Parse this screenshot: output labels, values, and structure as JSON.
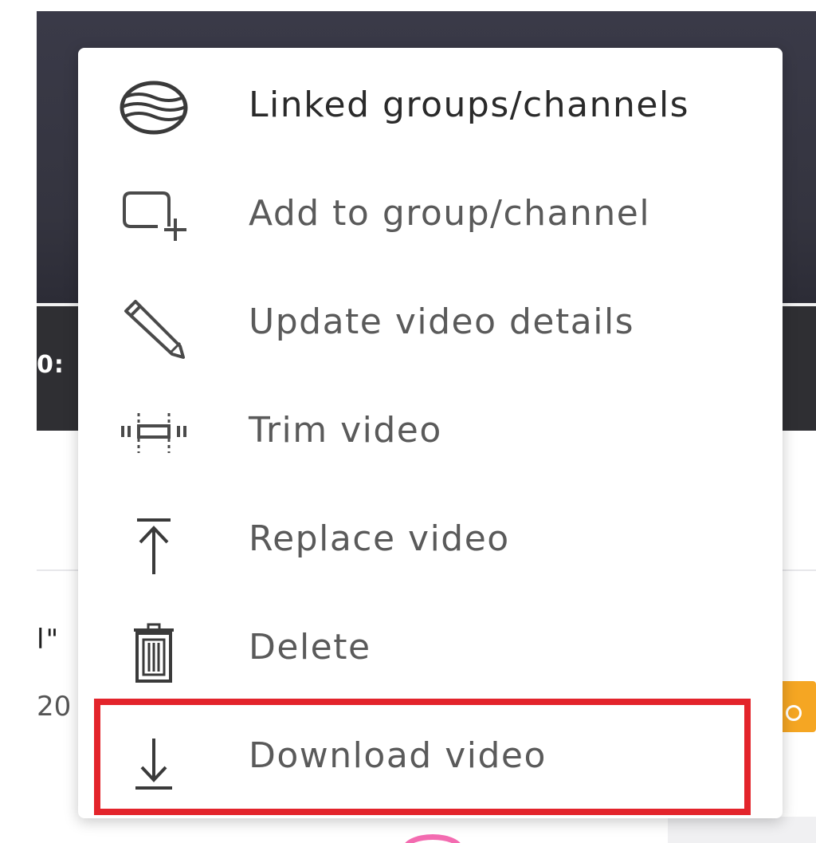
{
  "player": {
    "time": "0:",
    "peek_title": "l\"",
    "peek_date": "20"
  },
  "menu": {
    "items": [
      {
        "label": "Linked groups/channels",
        "icon": "linked-channels-icon"
      },
      {
        "label": "Add to group/channel",
        "icon": "add-to-group-icon"
      },
      {
        "label": "Update video details",
        "icon": "pencil-icon"
      },
      {
        "label": "Trim video",
        "icon": "trim-icon"
      },
      {
        "label": "Replace video",
        "icon": "upload-icon"
      },
      {
        "label": "Delete",
        "icon": "trash-icon"
      },
      {
        "label": "Download video",
        "icon": "download-icon"
      }
    ]
  },
  "colors": {
    "highlight": "#e3242b",
    "video_bg": "#34343f",
    "player_bar": "#2f2f33",
    "menu_text": "#5a5a5a",
    "accent_orange": "#f5a623",
    "accent_pink": "#f36bb0"
  }
}
